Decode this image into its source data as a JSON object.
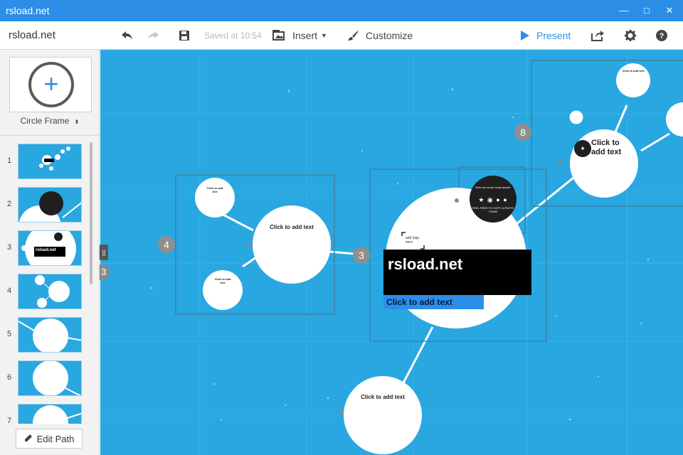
{
  "window": {
    "title": "rsload.net"
  },
  "toolbar": {
    "app_name": "rsload.net",
    "saved": "Saved at 10:54",
    "insert": "Insert",
    "customize": "Customize",
    "present": "Present"
  },
  "sidebar": {
    "frame_label": "Circle Frame",
    "slides": [
      {
        "num": "1"
      },
      {
        "num": "2"
      },
      {
        "num": "3"
      },
      {
        "num": "4"
      },
      {
        "num": "5"
      },
      {
        "num": "6"
      },
      {
        "num": "7"
      }
    ],
    "thumb3_label": "rsload.net",
    "edit_path": "Edit Path",
    "handle_num": "3"
  },
  "canvas": {
    "badges": {
      "b4": "4",
      "b3": "3",
      "b8": "8"
    },
    "title": "rsload.net",
    "click_add_text": "Click to add text",
    "logo_here": "add logo here",
    "bubble_top": "Here are some extra assets:",
    "bubble_icons": "★ ◉ ● ●",
    "bubble_bottom": "FEEL FREE TO COPY & PASTE THEM!",
    "big_click": "Click to\nadd text",
    "colors": {
      "canvas": "#29a7e1",
      "accent": "#2d8ee8",
      "dark": "#1f1f1f"
    }
  }
}
